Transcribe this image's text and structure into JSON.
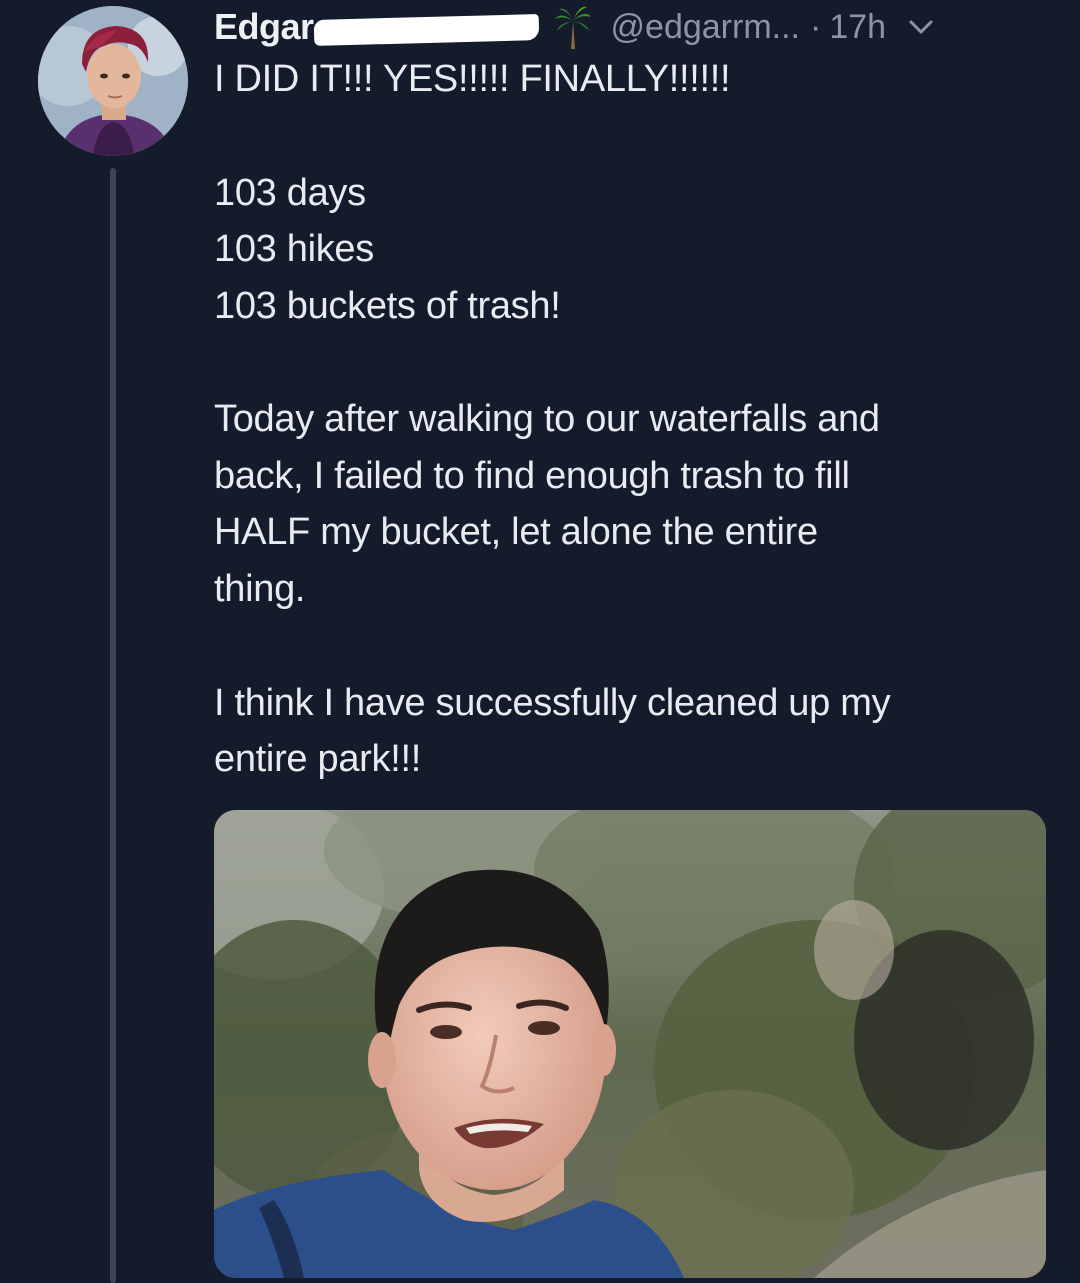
{
  "tweet": {
    "display_name": "Edgar",
    "handle": "@edgarrm...",
    "separator": "·",
    "timestamp": "17h",
    "icons": {
      "emoji": "palm-tree-icon",
      "menu": "chevron-down-icon"
    },
    "lines": [
      "I DID IT!!! YES!!!!! FINALLY!!!!!!",
      "103 days",
      "103 hikes",
      "103 buckets of trash!",
      "Today after walking to our waterfalls and",
      "back, I failed to find enough trash to fill",
      "HALF my bucket, let alone the entire",
      "thing.",
      "I think I have successfully cleaned up my",
      "entire park!!!"
    ]
  },
  "colors": {
    "background": "#141b2b",
    "text": "#e8ebef",
    "secondary_text": "#8a96a3",
    "thread_line": "#3b4756"
  }
}
